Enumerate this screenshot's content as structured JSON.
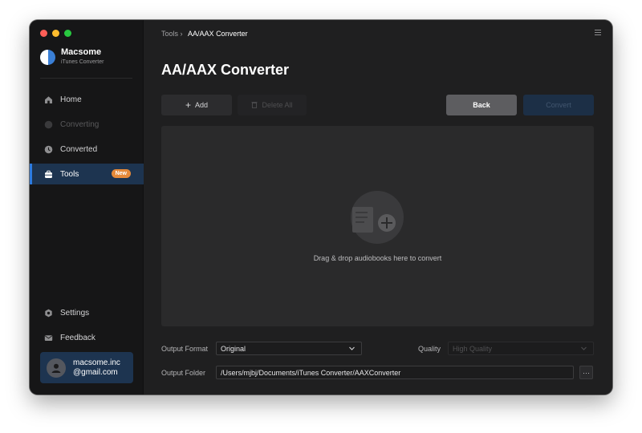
{
  "window": {
    "traffic_colors": [
      "#ff5f57",
      "#febc2e",
      "#28c840"
    ]
  },
  "brand": {
    "name": "Macsome",
    "subtitle": "iTunes Converter"
  },
  "sidebar": {
    "items": [
      {
        "label": "Home",
        "icon": "home-icon",
        "state": "normal"
      },
      {
        "label": "Converting",
        "icon": "converting-icon",
        "state": "disabled"
      },
      {
        "label": "Converted",
        "icon": "clock-icon",
        "state": "normal"
      },
      {
        "label": "Tools",
        "icon": "toolbox-icon",
        "state": "active",
        "badge": "New"
      }
    ],
    "bottom_items": [
      {
        "label": "Settings",
        "icon": "gear-icon"
      },
      {
        "label": "Feedback",
        "icon": "mail-icon"
      }
    ],
    "user": {
      "email_line1": "macsome.inc",
      "email_line2": "@gmail.com"
    }
  },
  "header": {
    "breadcrumb_root": "Tools",
    "breadcrumb_sep": "›",
    "breadcrumb_current": "AA/AAX Converter"
  },
  "page": {
    "title": "AA/AAX Converter"
  },
  "toolbar": {
    "add_label": "Add",
    "delete_all_label": "Delete All",
    "back_label": "Back",
    "convert_label": "Convert"
  },
  "dropzone": {
    "text": "Drag & drop audiobooks here to convert"
  },
  "settings": {
    "output_format_label": "Output Format",
    "output_format_value": "Original",
    "quality_label": "Quality",
    "quality_value": "High Quality",
    "output_folder_label": "Output Folder",
    "output_folder_value": "/Users/mjbj/Documents/iTunes Converter/AAXConverter",
    "browse_label": "···"
  },
  "colors": {
    "accent": "#2d7be0",
    "badge": "#e68a3a",
    "active_bg": "#1d3450"
  }
}
